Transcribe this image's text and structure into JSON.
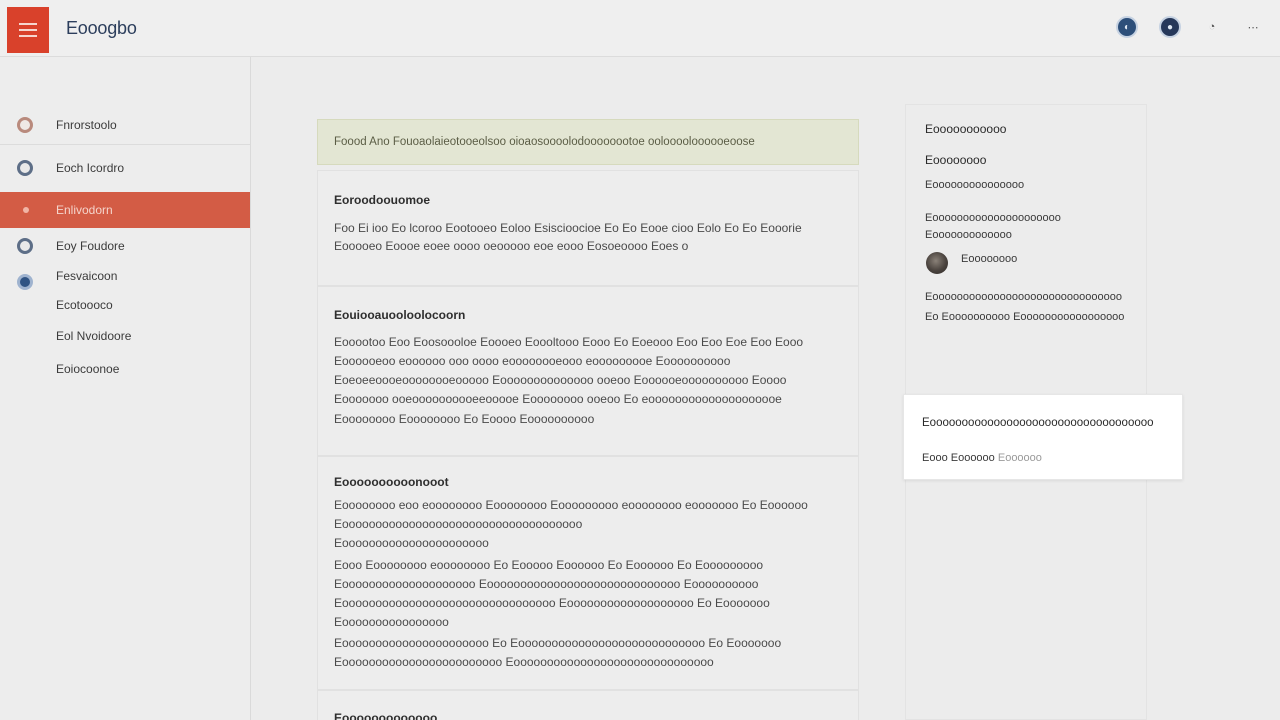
{
  "header": {
    "title": "Eooogbo",
    "icons": [
      "user-icon",
      "settings-icon",
      "help-icon",
      "more-icon"
    ]
  },
  "sidebar": {
    "items": [
      {
        "label": "Fnrorstoolo",
        "icon": "ring"
      },
      {
        "label": "Eoch Icordro",
        "icon": "ring"
      },
      {
        "label": "Enlivodorn",
        "icon": "dot",
        "active": true
      },
      {
        "label": "Eoy Foudore",
        "icon": "ring"
      },
      {
        "label": "Fesvaicoon",
        "icon": "disc"
      },
      {
        "label": "Ecotoooco",
        "icon": ""
      },
      {
        "label": "Eol Nvoidoore",
        "icon": ""
      },
      {
        "label": "Eoiocoonoe",
        "icon": ""
      }
    ]
  },
  "main": {
    "alert": "Foood Ano Fouoaolaieotooeolsoo oioaosoooolodoooooootoe oolooooloooooeoose",
    "sections": [
      {
        "title": "Eoroodoouomoe",
        "lines": [
          "Foo Ei ioo Eo lcoroo Eootooeo Eoloo Esiscioocioe Eo Eo Eooe cioo Eolo Eo Eo Eooorie",
          "Eooooeo Eoooe eoee oooo oeooooo eoe eooo Eosoeoooo Eoes o"
        ]
      },
      {
        "title": "Eouiooauooloolocoorn",
        "lines": [
          "Eooootoo Eoo Eoosoooloe Eoooeo Eoooltooo Eooo Eo Eoeooo Eoo Eoo Eoe Eoo Eooo",
          "Eoooooeoo eoooooo ooo oooo eoooooooeooo eooooooooe Eoooooooooo",
          "Eoeoeeoooeoooooooeooooo Eoooooooooooooo ooeoo Eoooooeoooooooooo Eoooo",
          "Eooooooo ooeoooooooooeeooooe Eoooooooo ooeoo Eo eoooooooooooooooooooe",
          "Eoooooooo Eoooooooo Eo Eoooo Eoooooooooo"
        ]
      },
      {
        "title": "Eoooooooooonooot",
        "lines": [
          "Eoooooooo eoo eoooooooo Eoooooooo Eooooooooo eoooooooo eooooooo Eo Eoooooo",
          "Eoooooooooooooooooooooooooooooooooooo",
          "Eoooooooooooooooooooooo",
          "Eooo Eoooooooo eoooooooo Eo Eooooo Eoooooo Eo Eoooooo Eo Eooooooooo",
          "Eoooooooooooooooooooo Eooooooooooooooooooooooooooooo Eoooooooooo",
          "Eoooooooooooooooooooooooooooooooo Eooooooooooooooooooo Eo Eooooooo",
          "Eoooooooooooooooo",
          "Eoooooooooooooooooooooo Eo Eoooooooooooooooooooooooooooo Eo Eooooooo",
          "Eoooooooooooooooooooooooo Eoooooooooooooooooooooooooooooo"
        ]
      },
      {
        "title": "Eooooooooooooo",
        "lines": []
      }
    ]
  },
  "right_panel": {
    "heading": "Eooooooooooo",
    "subheading": "Eoooooooo",
    "line1": "Eooooooooooooooo",
    "line2": "Eooooooooooooooooooooo",
    "line3": "Eooooooooooooo",
    "avatar_name": "Eoooooooo",
    "line4": "Eooooooooooooooooooooooooooooooo",
    "line5": "Eo Eoooooooooo Eooooooooooooooooo"
  },
  "popup": {
    "title": "Eooooooooooooooooooooooooooooooooooo",
    "meta": "Eooo Eoooooo",
    "meta_muted": "Eoooooo"
  }
}
